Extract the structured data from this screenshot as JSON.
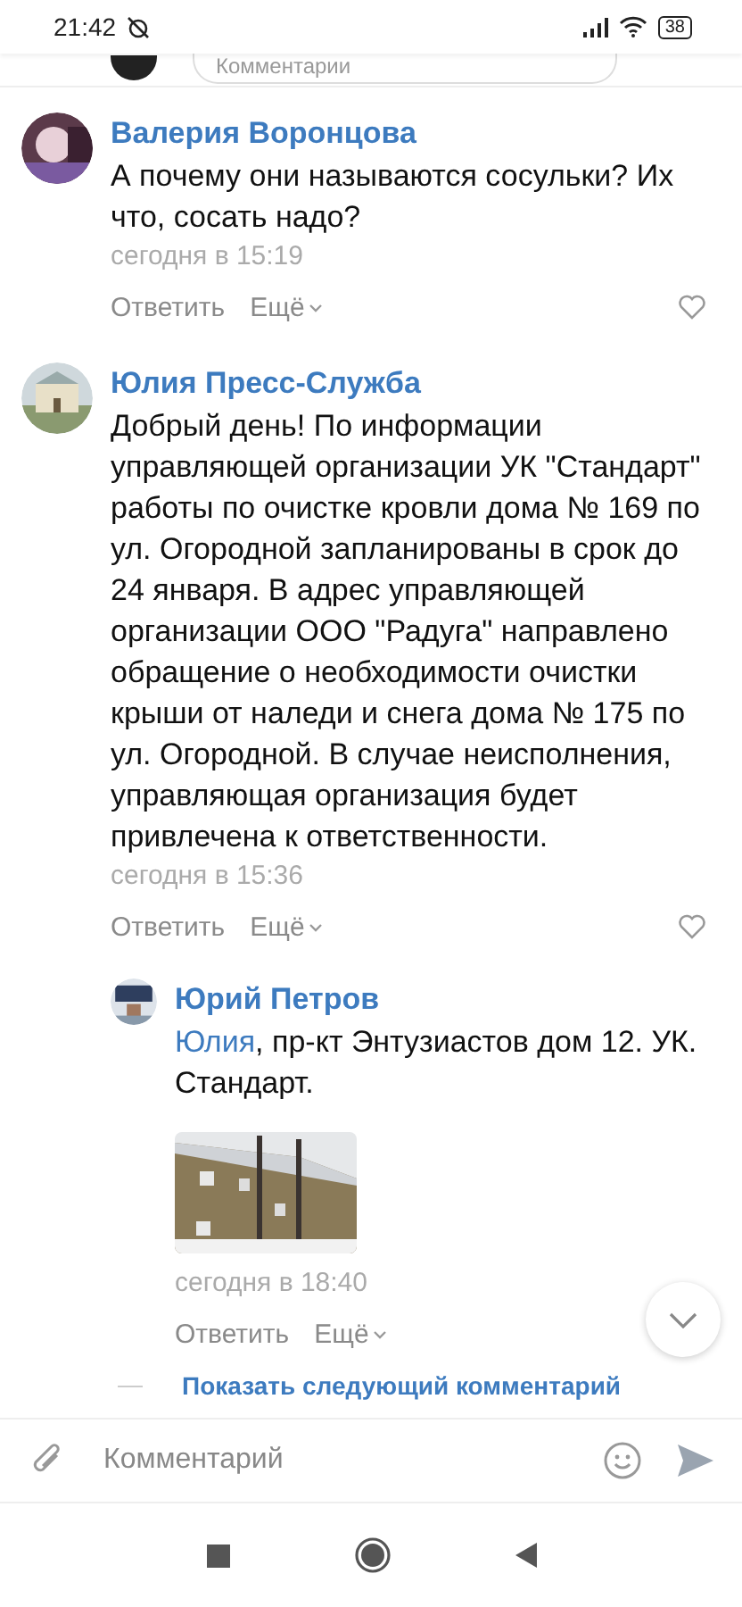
{
  "status_bar": {
    "time": "21:42",
    "battery": "38"
  },
  "top_field": {
    "placeholder": "Комментарии"
  },
  "comments": [
    {
      "kind": "comment",
      "author": "Валерия Воронцова",
      "text": "А почему они называются сосульки? Их что, сосать надо?",
      "time": "сегодня в 15:19",
      "reply": "Ответить",
      "more": "Ещё"
    },
    {
      "kind": "comment",
      "author": "Юлия Пресс-Служба",
      "text": "Добрый день! По информации управляющей организации УК \"Стандарт\" работы по очистке кровли дома № 169 по ул. Огородной запланированы в срок до 24 января. В адрес управляющей организации ООО \"Радуга\" направлено обращение о необходимости очистки крыши от наледи и снега дома № 175 по ул. Огородной. В случае неисполнения, управляющая организация будет привлечена к ответственности.",
      "time": "сегодня в 15:36",
      "reply": "Ответить",
      "more": "Ещё"
    },
    {
      "kind": "reply",
      "author": "Юрий Петров",
      "mention": "Юлия",
      "text": ", пр-кт Энтузиастов дом 12. УК. Стандарт.",
      "time": "сегодня в 18:40",
      "reply": "Ответить",
      "more": "Ещё"
    }
  ],
  "show_next": "Показать следующий комментарий",
  "composer": {
    "placeholder": "Комментарий"
  }
}
